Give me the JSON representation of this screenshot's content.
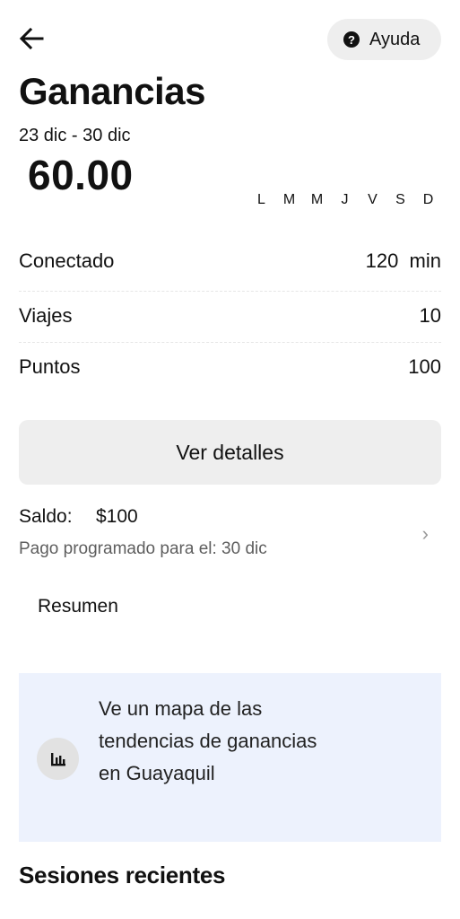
{
  "header": {
    "help_label": "Ayuda",
    "help_icon_glyph": "?"
  },
  "earnings": {
    "title": "Ganancias",
    "date_range": "23 dic - 30 dic",
    "total": "60.00",
    "weekdays": [
      "L",
      "M",
      "M",
      "J",
      "V",
      "S",
      "D"
    ]
  },
  "stats": [
    {
      "label": "Conectado",
      "value": "120  min"
    },
    {
      "label": "Viajes",
      "value": "10"
    },
    {
      "label": "Puntos",
      "value": "100"
    }
  ],
  "details_button": "Ver detalles",
  "balance": {
    "label": "Saldo:",
    "value": "$100",
    "scheduled": "Pago programado para el: 30 dic",
    "chevron": "›"
  },
  "summary_tab": "Resumen",
  "promo": {
    "text": "Ve un mapa de las tendencias de ganancias en Guayaquil",
    "icon": "bar-chart-icon",
    "background": "#edf2fd"
  },
  "recent_sessions_title": "Sesiones recientes"
}
